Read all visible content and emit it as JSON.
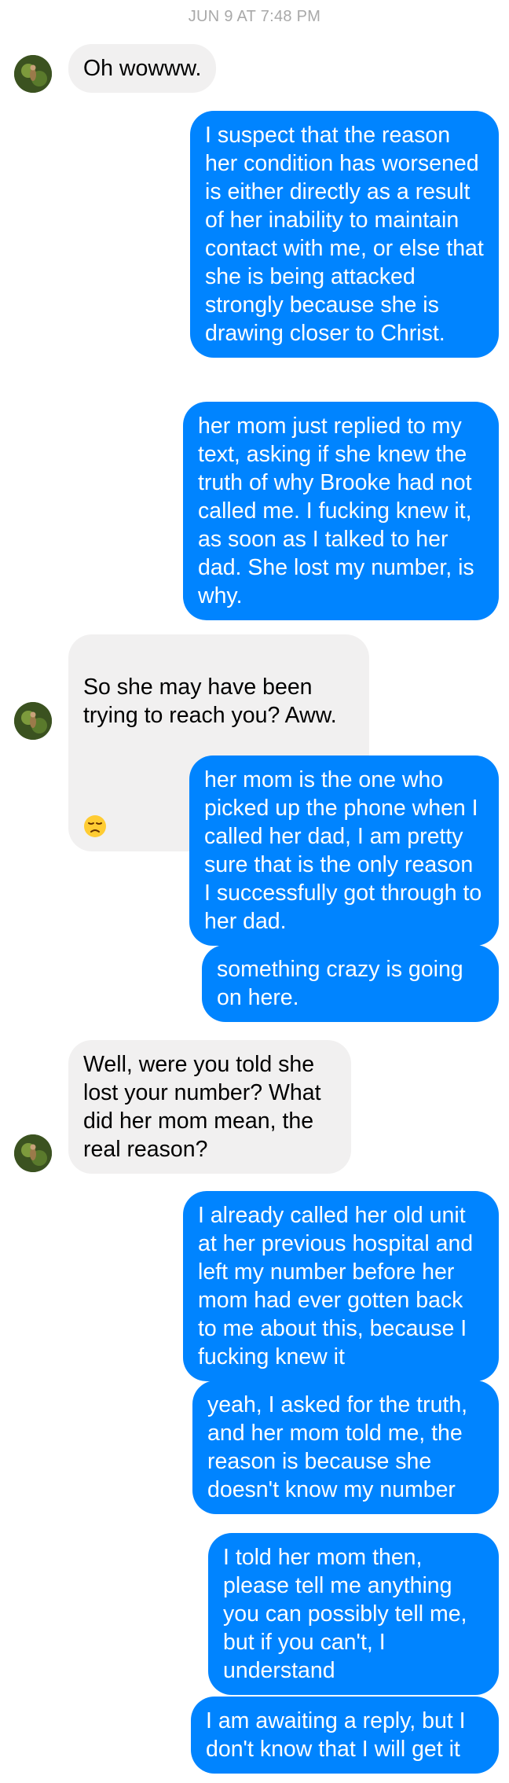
{
  "header": {
    "timestamp": "JUN 9 AT 7:48 PM"
  },
  "colors": {
    "outgoing_bubble": "#0084ff",
    "incoming_bubble": "#f1f0f0",
    "timestamp_text": "#a9a9a9"
  },
  "messages": [
    {
      "sender": "contact",
      "text": "Oh wowww."
    },
    {
      "sender": "me",
      "text": "I suspect that the reason her condition has worsened is either directly as a result of her inability to maintain contact with me, or else that she is being attacked strongly because she is drawing closer to Christ."
    },
    {
      "sender": "me",
      "text": "her mom just replied to my text, asking if she knew the truth of why Brooke had not called me. I fucking knew it, as soon as I talked to her dad. She lost my number, is why."
    },
    {
      "sender": "contact",
      "text": "So she may have been trying to reach you? Aww.",
      "emoji": "disappointed-face-icon"
    },
    {
      "sender": "me",
      "text": "her mom is the one who picked up the phone when I called her dad, I am pretty sure that is the only reason I successfully got through to her dad."
    },
    {
      "sender": "me",
      "text": "something crazy is going on here."
    },
    {
      "sender": "contact",
      "text": "Well, were you told she lost your number? What did her mom mean, the real reason?"
    },
    {
      "sender": "me",
      "text": "I already called her old unit at her previous hospital and left my number before her mom had ever gotten back to me about this, because I fucking knew it"
    },
    {
      "sender": "me",
      "text": "yeah, I asked for the truth, and her mom told me, the reason is because she doesn't know my number"
    },
    {
      "sender": "me",
      "text": "I told her mom then, please tell me anything you can possibly tell me, but if you can't, I understand"
    },
    {
      "sender": "me",
      "text": "I am awaiting a reply, but I don't know that I will get it"
    }
  ]
}
